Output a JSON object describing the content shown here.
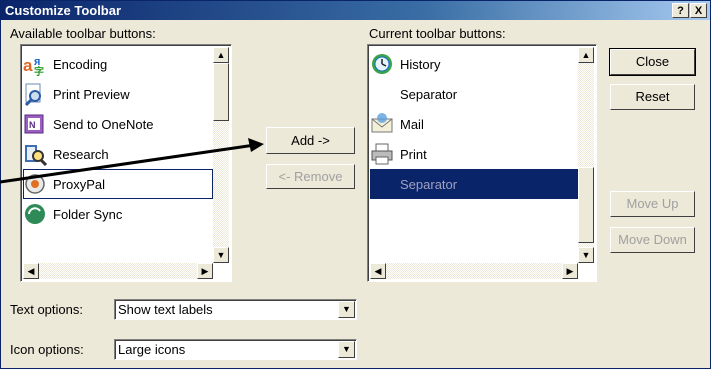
{
  "title": "Customize Toolbar",
  "title_buttons": {
    "help": "?",
    "close": "X"
  },
  "available": {
    "label": "Available toolbar buttons:",
    "items": [
      {
        "label": "Encoding",
        "icon": "encoding-icon"
      },
      {
        "label": "Print Preview",
        "icon": "print-preview-icon"
      },
      {
        "label": "Send to OneNote",
        "icon": "onenote-icon"
      },
      {
        "label": "Research",
        "icon": "research-icon"
      },
      {
        "label": "ProxyPal",
        "icon": "proxypal-icon"
      },
      {
        "label": "Folder Sync",
        "icon": "folder-sync-icon"
      }
    ]
  },
  "current": {
    "label": "Current toolbar buttons:",
    "items": [
      {
        "label": "History",
        "icon": "history-icon"
      },
      {
        "label": "Separator",
        "icon": ""
      },
      {
        "label": "Mail",
        "icon": "mail-icon"
      },
      {
        "label": "Print",
        "icon": "print-icon"
      },
      {
        "label": "Separator",
        "icon": "",
        "selected": true
      }
    ]
  },
  "buttons": {
    "add": "Add ->",
    "remove": "<- Remove",
    "close": "Close",
    "reset": "Reset",
    "move_up": "Move Up",
    "move_down": "Move Down"
  },
  "text_options": {
    "label": "Text options:",
    "value": "Show text labels"
  },
  "icon_options": {
    "label": "Icon options:",
    "value": "Large icons"
  },
  "colors": {
    "title_bar": "#0a246a",
    "selection": "#0a246a",
    "dialog_bg": "#ece9d8"
  }
}
